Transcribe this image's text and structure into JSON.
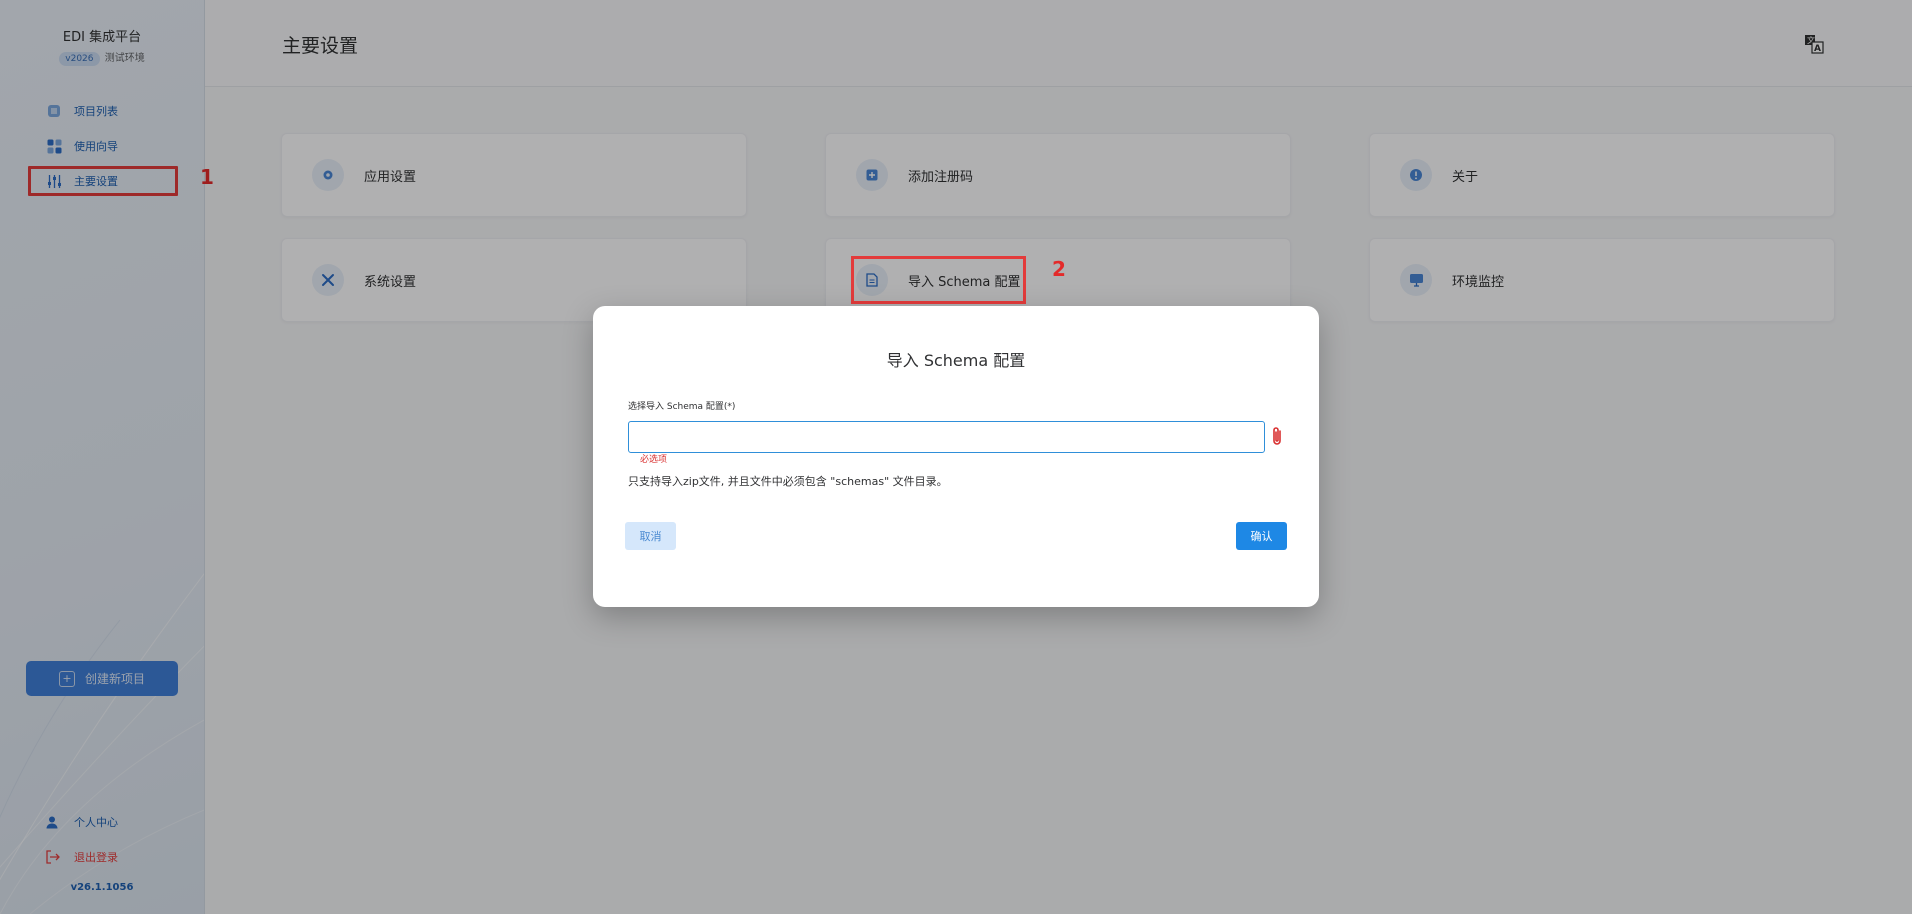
{
  "app": {
    "title": "EDI 集成平台",
    "version_pill": "v2026",
    "environment": "测试环境",
    "build_version": "v26.1.1056"
  },
  "sidebar": {
    "items": [
      {
        "label": "项目列表",
        "icon": "project-list-icon"
      },
      {
        "label": "使用向导",
        "icon": "guide-grid-icon"
      },
      {
        "label": "主要设置",
        "icon": "settings-sliders-icon",
        "active": true
      }
    ],
    "create_button": "创建新项目",
    "bottom_items": [
      {
        "label": "个人中心",
        "icon": "user-icon",
        "color": "#1e5fb0"
      },
      {
        "label": "退出登录",
        "icon": "logout-icon",
        "color": "#e34040"
      }
    ]
  },
  "header": {
    "title": "主要设置",
    "lang_icon": "translate-icon"
  },
  "cards": [
    {
      "label": "应用设置",
      "icon": "gear-icon"
    },
    {
      "label": "添加注册码",
      "icon": "plus-square-icon"
    },
    {
      "label": "关于",
      "icon": "info-icon"
    },
    {
      "label": "系统设置",
      "icon": "tools-icon"
    },
    {
      "label": "导入 Schema 配置",
      "icon": "document-icon"
    },
    {
      "label": "环境监控",
      "icon": "monitor-icon"
    }
  ],
  "annotations": {
    "callout_1": "1",
    "callout_2": "2"
  },
  "dialog": {
    "title": "导入 Schema 配置",
    "field_label": "选择导入 Schema 配置(*)",
    "input_value": "",
    "error": "必选项",
    "hint": "只支持导入zip文件, 并且文件中必须包含 \"schemas\" 文件目录。",
    "cancel": "取消",
    "confirm": "确认"
  },
  "colors": {
    "accent": "#1e88e5",
    "nav_text": "#1e5fb0",
    "annotation_red": "#e33b3b",
    "error": "#d93030"
  }
}
